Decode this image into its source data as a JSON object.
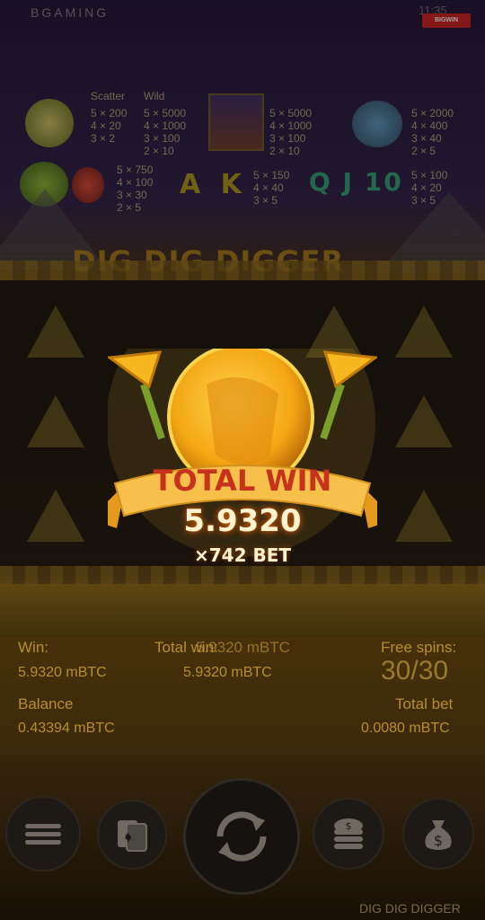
{
  "status_bar": {
    "brand": "BGAMING",
    "time": "11:35",
    "watermark": "BIGWIN PICTURES"
  },
  "paytable": {
    "scatter_label": "Scatter",
    "wild_label": "Wild",
    "scatter_payouts": [
      "5 × 200",
      "4 × 20",
      "3 × 2"
    ],
    "wild_payouts": [
      "5 × 5000",
      "4 × 1000",
      "3 × 100",
      "2 × 10"
    ],
    "pharaoh_payouts": [
      "5 × 5000",
      "4 × 1000",
      "3 × 100",
      "2 × 10"
    ],
    "pot_payouts": [
      "5 × 2000",
      "4 × 400",
      "3 × 40",
      "2 × 5"
    ],
    "scarab_payouts": [
      "5 × 750",
      "4 × 100",
      "3 × 30",
      "2 × 5"
    ],
    "ak_letters": "A K",
    "ak_payouts": [
      "5 × 150",
      "4 × 40",
      "3 × 5"
    ],
    "q_j_10_letters": "Q J 10",
    "q_j_10_payouts": [
      "5 × 100",
      "4 × 20",
      "3 × 5"
    ]
  },
  "game_logo": "DIG DIG DIGGER",
  "win_popup": {
    "title": "TOTAL WIN",
    "amount": "5.9320",
    "multiplier": "×742 BET"
  },
  "hud": {
    "win_label": "Win:",
    "win_value": "5.9320 mBTC",
    "total_win_label": "Total win:",
    "total_win_value": "5.9320 mBTC",
    "total_win_ghost": "5.9320 mBTC",
    "free_spins_label": "Free spins:",
    "free_spins_value": "30/30",
    "balance_label": "Balance",
    "balance_value": "0.43394 mBTC",
    "total_bet_label": "Total bet",
    "total_bet_value": "0.0080 mBTC"
  },
  "footer": {
    "game_name": "DIG DIG DIGGER"
  },
  "colors": {
    "gold": "#f4b521",
    "ribbon": "#f6c04a",
    "win_text": "#c6321b",
    "hud_text": "#b88e2e"
  },
  "icons": [
    "menu-icon",
    "cards-icon",
    "spin-icon",
    "coins-icon",
    "money-bag-icon"
  ]
}
